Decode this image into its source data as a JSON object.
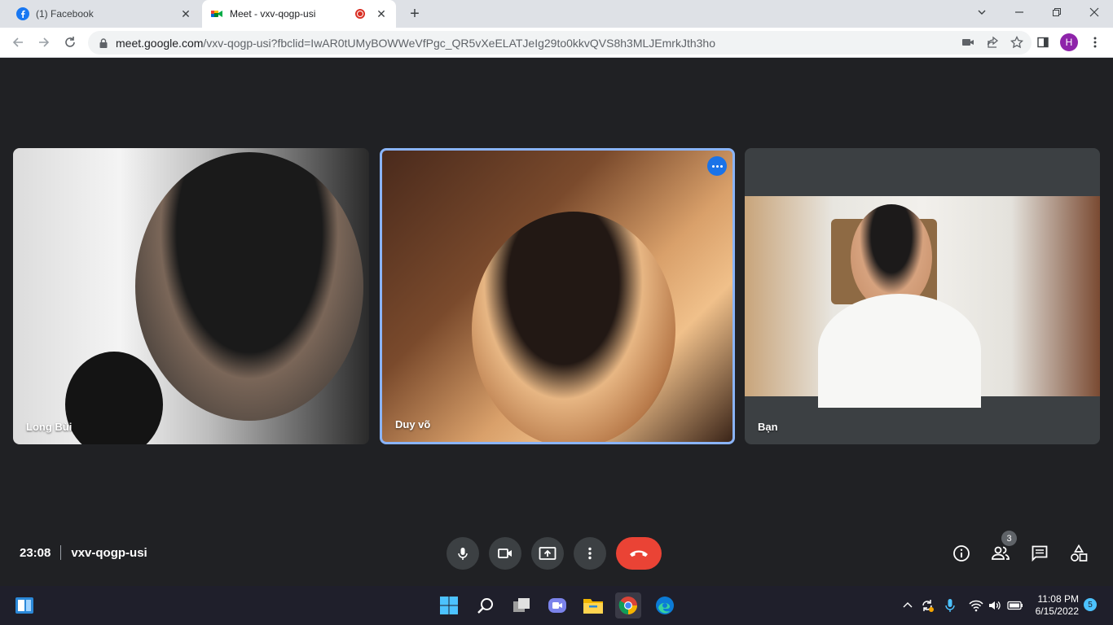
{
  "browser": {
    "tabs": [
      {
        "title": "(1) Facebook",
        "icon": "facebook-icon"
      },
      {
        "title": "Meet - vxv-qogp-usi",
        "icon": "google-meet-icon",
        "recording": true
      }
    ],
    "url": {
      "host": "meet.google.com",
      "path": "/vxv-qogp-usi?fbclid=IwAR0tUMyBOWWeVfPgc_QR5vXeELATJeIg29to0kkvQVS8h3MLJEmrkJth3ho"
    },
    "profile_initial": "H"
  },
  "meet": {
    "participants": [
      {
        "name": "Long Bùi"
      },
      {
        "name": "Duy võ"
      },
      {
        "name": "Bạn"
      }
    ],
    "time": "23:08",
    "meeting_code": "vxv-qogp-usi",
    "people_count": "3"
  },
  "taskbar": {
    "time": "11:08 PM",
    "date": "6/15/2022",
    "notifications": "5"
  },
  "colors": {
    "accent": "#1a73e8",
    "end_call": "#ea4335",
    "background": "#202124"
  }
}
